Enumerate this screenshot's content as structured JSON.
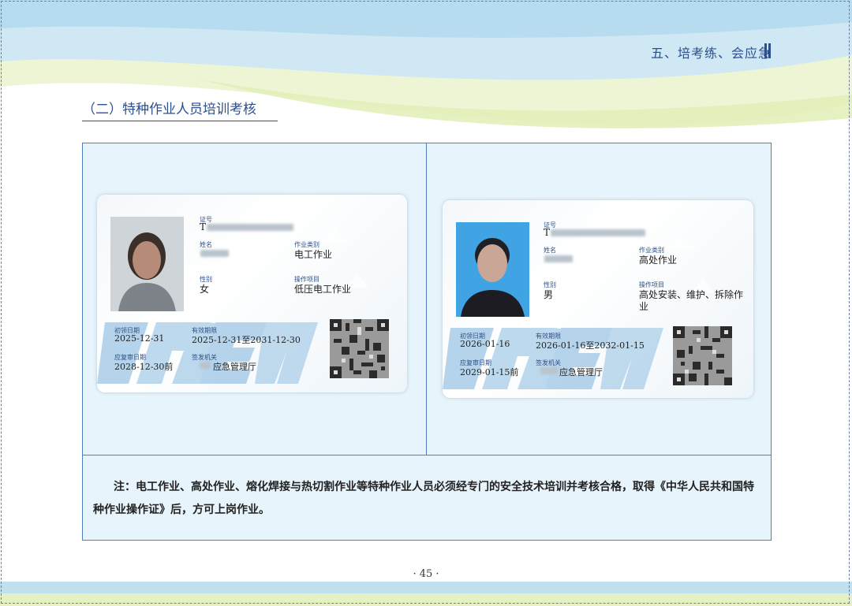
{
  "header": {
    "title": "五、培考练、会应急"
  },
  "section": {
    "title": "（二）特种作业人员培训考核"
  },
  "labels": {
    "cert_no": "证号",
    "name": "姓名",
    "job_category": "作业类别",
    "gender": "性别",
    "operation_item": "操作项目",
    "first_issue_date": "初领日期",
    "validity": "有效期限",
    "review_date": "应复审日期",
    "issuing_authority": "签发机关"
  },
  "cards": [
    {
      "cert_prefix": "T",
      "job_category": "电工作业",
      "gender": "女",
      "operation_item": "低压电工作业",
      "first_issue_date": "2025-12-31",
      "validity": "2025-12-31至2031-12-30",
      "review_date": "2028-12-30前",
      "issuing_authority": "应急管理厅"
    },
    {
      "cert_prefix": "T",
      "job_category": "高处作业",
      "gender": "男",
      "operation_item_line1": "高处安装、维护、拆除作",
      "operation_item_line2": "业",
      "first_issue_date": "2026-01-16",
      "validity": "2026-01-16至2032-01-15",
      "review_date": "2029-01-15前",
      "issuing_authority": "应急管理厅"
    }
  ],
  "note": {
    "text": "注：电工作业、高处作业、熔化焊接与热切割作业等特种作业人员必须经专门的安全技术培训并考核合格，取得《中华人民共和国特种作业操作证》后，方可上岗作业。"
  },
  "footer": {
    "page_number": "· 45 ·"
  },
  "colors": {
    "accent": "#2c4f8f",
    "frame_border": "#4f7fbf",
    "frame_bg": "#e7f4fb",
    "header_green": "#e3f0b8",
    "header_blue": "#c6e6f5"
  }
}
